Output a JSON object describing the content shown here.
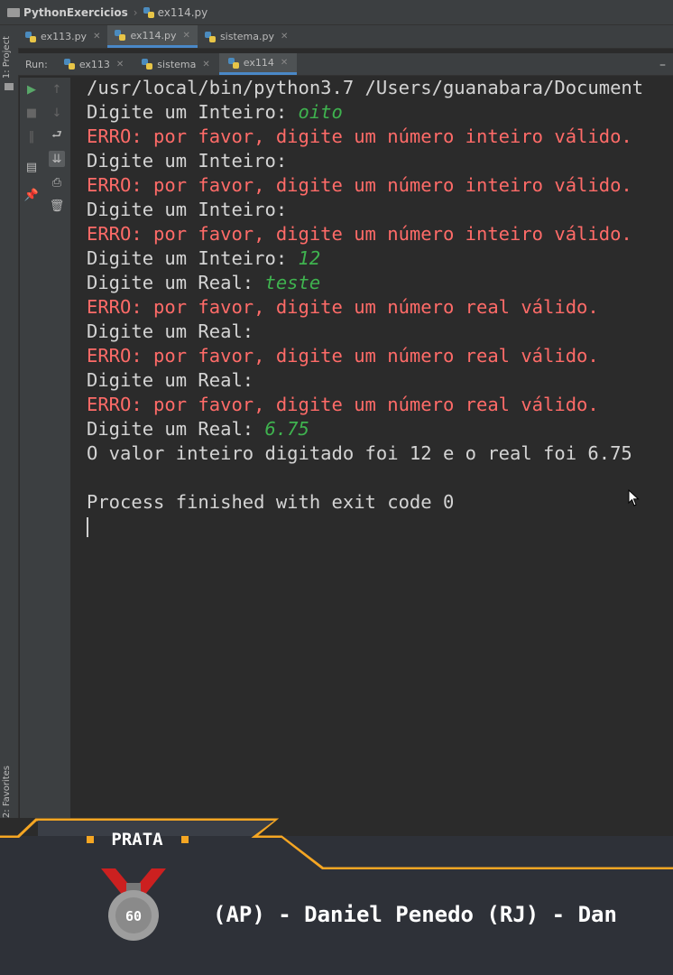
{
  "breadcrumb": {
    "project": "PythonExercicios",
    "file": "ex114.py"
  },
  "left_panel": {
    "project_label": "1: Project",
    "favorites_label": "2: Favorites"
  },
  "editor_tabs": [
    {
      "label": "ex113.py",
      "active": false
    },
    {
      "label": "ex114.py",
      "active": true
    },
    {
      "label": "sistema.py",
      "active": false
    }
  ],
  "run_bar": {
    "label": "Run:",
    "tabs": [
      {
        "label": "ex113",
        "active": false
      },
      {
        "label": "sistema",
        "active": false
      },
      {
        "label": "ex114",
        "active": true
      }
    ]
  },
  "console": {
    "path_line": "/usr/local/bin/python3.7 /Users/guanabara/Document",
    "prompt_int": "Digite um Inteiro: ",
    "prompt_real": "Digite um Real: ",
    "err_int": "ERRO: por favor, digite um número inteiro válido.",
    "err_real": "ERRO: por favor, digite um número real válido.",
    "inputs": {
      "oito": "oito",
      "doze": "12",
      "teste": "teste",
      "real": "6.75"
    },
    "result_line": "O valor inteiro digitado foi 12 e o real foi 6.75",
    "exit_line": "Process finished with exit code 0"
  },
  "overlay": {
    "badge": "PRATA",
    "medal_number": "60",
    "ticker": "(AP) - Daniel Penedo (RJ) - Dan",
    "colors": {
      "accent": "#f5a623",
      "panel": "#2e3138"
    }
  }
}
